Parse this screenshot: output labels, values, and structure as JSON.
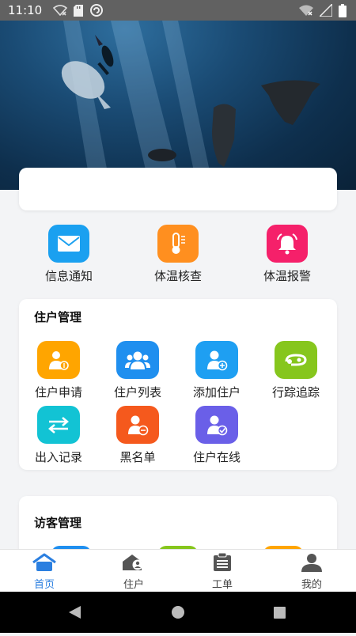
{
  "status_bar": {
    "time": "11:10"
  },
  "quick_actions": [
    {
      "label": "信息通知",
      "icon": "mail-icon",
      "color": "#1aa0f0"
    },
    {
      "label": "体温核查",
      "icon": "thermometer-icon",
      "color": "#ff8f1f"
    },
    {
      "label": "体温报警",
      "icon": "alarm-bell-icon",
      "color": "#f5206a"
    }
  ],
  "resident_section": {
    "title": "住户管理",
    "items": [
      {
        "label": "住户申请",
        "icon": "user-apply-icon",
        "color": "#ffa500"
      },
      {
        "label": "住户列表",
        "icon": "user-group-icon",
        "color": "#1f8fef"
      },
      {
        "label": "添加住户",
        "icon": "user-add-icon",
        "color": "#1e9ff2"
      },
      {
        "label": "行踪追踪",
        "icon": "track-icon",
        "color": "#86c61d"
      },
      {
        "label": "出入记录",
        "icon": "swap-arrows-icon",
        "color": "#12c3d4"
      },
      {
        "label": "黑名单",
        "icon": "user-remove-icon",
        "color": "#f5591d"
      },
      {
        "label": "住户在线",
        "icon": "user-check-icon",
        "color": "#6a5fe8"
      }
    ]
  },
  "visitor_section": {
    "title": "访客管理",
    "peek_colors": [
      "#1f8fef",
      "#86c61d",
      "#ffa500"
    ]
  },
  "tab_bar": [
    {
      "label": "首页",
      "icon": "home-icon",
      "active": true
    },
    {
      "label": "住户",
      "icon": "house-user-icon",
      "active": false
    },
    {
      "label": "工单",
      "icon": "clipboard-icon",
      "active": false
    },
    {
      "label": "我的",
      "icon": "profile-icon",
      "active": false
    }
  ],
  "colors": {
    "accent": "#2b7fe0",
    "page_bg": "#f3f4f6",
    "status_bar": "#616161"
  }
}
